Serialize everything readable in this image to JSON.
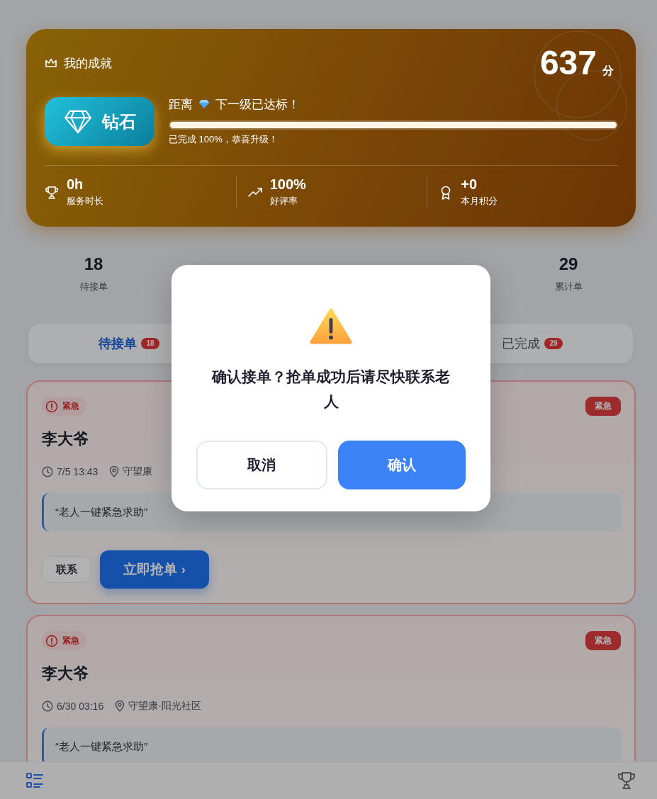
{
  "achievement": {
    "title": "我的成就",
    "score": "637",
    "score_unit": "分",
    "level_badge": "钻石",
    "next_level_prefix": "距离",
    "next_level_suffix": "下一级已达标！",
    "progress": {
      "level": 1,
      "caption": "已完成 100%，恭喜升级！"
    },
    "stats": [
      {
        "value": "0h",
        "label": "服务时长"
      },
      {
        "value": "100%",
        "label": "好评率"
      },
      {
        "value": "+0",
        "label": "本月积分"
      }
    ]
  },
  "counts": [
    {
      "value": "18",
      "label": "待接单"
    },
    {
      "value": "29",
      "label": "累计单"
    }
  ],
  "tabs": [
    {
      "label": "待接单",
      "badge": "18",
      "selected": true
    },
    {
      "label": "已完成",
      "badge": "29",
      "selected": false
    }
  ],
  "orders": [
    {
      "urgent": true,
      "urgency_label": "紧急",
      "tag": "紧急",
      "name": "李大爷",
      "time": "7/5 13:43",
      "address": "守望康",
      "note": "“老人一键紧急求助”",
      "actions": [
        {
          "kind": "secondary",
          "label": "联系"
        },
        {
          "kind": "primary",
          "label": "立即抢单 ›"
        }
      ]
    },
    {
      "urgent": true,
      "urgency_label": "紧急",
      "tag": "紧急",
      "name": "李大爷",
      "time": "6/30 03:16",
      "address": "守望康·阳光社区",
      "note": "“老人一键紧急求助”"
    }
  ],
  "bottom_nav": [
    {
      "kind": "list",
      "selected": true
    },
    {
      "kind": "trophy",
      "selected": false
    }
  ],
  "dialog": {
    "message": "确认接单？抢单成功后请尽快联系老人",
    "buttons": [
      {
        "kind": "secondary",
        "label": "取消"
      },
      {
        "kind": "primary",
        "label": "确认"
      }
    ]
  }
}
